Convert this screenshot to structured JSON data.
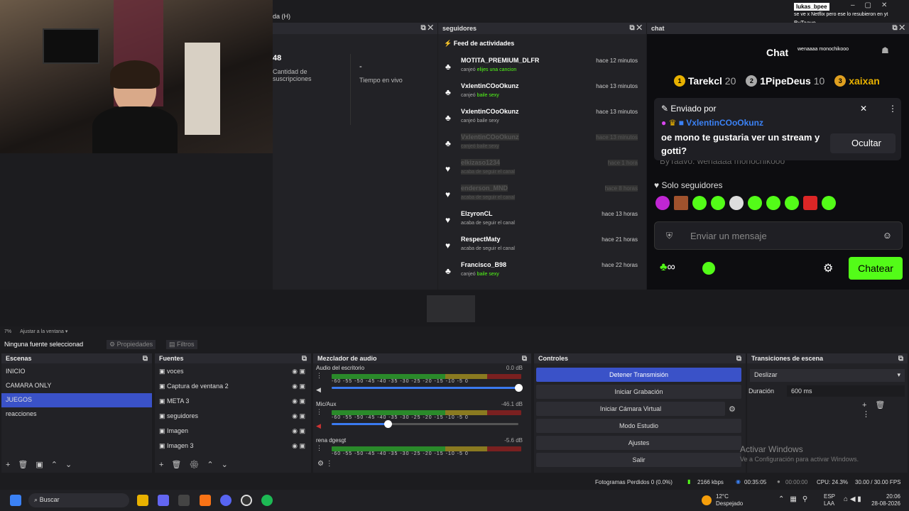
{
  "topbar": {
    "partial_title": "da (H)",
    "notif_user": "lukas_bpee",
    "notif_msg": "se ve x Netflix pero ese lo resubieron en yt",
    "notif_by": "ByTaavo",
    "notif_msg2": "wenaaaa monochikooo",
    "chat_heading": "Chat"
  },
  "stats_dock": {
    "count_partial": "48",
    "count_label": "Cantidad de suscripciones",
    "live_value": "-",
    "live_label": "Tiempo en vivo"
  },
  "followers_dock": {
    "title": "seguidores",
    "feed_title": "Feed de actividades",
    "rows": [
      {
        "icon": "♣",
        "name": "MOTITA_PREMIUM_DLFR",
        "act_prefix": "canjeó",
        "act_hl": "elijes una cancion",
        "time": "hace 12 minutos",
        "dim": false
      },
      {
        "icon": "♣",
        "name": "VxlentinCOoOkunz",
        "act_prefix": "canjeó",
        "act_hl": "baile sexy",
        "time": "hace 13 minutos",
        "dim": false
      },
      {
        "icon": "♣",
        "name": "VxlentinCOoOkunz",
        "act_prefix": "canjeó baile sexy",
        "act_hl": "",
        "time": "hace 13 minutos",
        "dim": false
      },
      {
        "icon": "♣",
        "name": "VxlentinCOoOkunz",
        "act_prefix": "canjeó baile sexy",
        "act_hl": "",
        "time": "hace 13 minutos",
        "dim": true
      },
      {
        "icon": "♥",
        "name": "elkizaso1234",
        "act_prefix": "acaba de seguir el canal",
        "act_hl": "",
        "time": "hace 1 hora",
        "dim": true
      },
      {
        "icon": "♥",
        "name": "enderson_MND",
        "act_prefix": "acaba de seguir el canal",
        "act_hl": "",
        "time": "hace 8 horas",
        "dim": true
      },
      {
        "icon": "♥",
        "name": "ElzyronCL",
        "act_prefix": "acaba de seguir el canal",
        "act_hl": "",
        "time": "hace 13 horas",
        "dim": false
      },
      {
        "icon": "♥",
        "name": "RespectMaty",
        "act_prefix": "acaba de seguir el canal",
        "act_hl": "",
        "time": "hace 21 horas",
        "dim": false
      },
      {
        "icon": "♣",
        "name": "Francisco_B98",
        "act_prefix": "canjeó",
        "act_hl": "baile sexy",
        "time": "hace 22 horas",
        "dim": false
      }
    ]
  },
  "chat_dock": {
    "title": "chat",
    "leaders": [
      {
        "rank": "1",
        "name": "Tarekcl",
        "score": "20",
        "color": "#e8b100"
      },
      {
        "rank": "2",
        "name": "1PipeDeus",
        "score": "10",
        "color": "#aaaaaa"
      },
      {
        "rank": "3",
        "name": "xaixan",
        "score": "",
        "color": "#e0a020"
      }
    ],
    "pinned_label": "Enviado por",
    "pinned_user": "VxlentinCOoOkunz",
    "pinned_msg": "oe mono te gustaria ver un stream y gotti?",
    "hide_label": "Ocultar",
    "bg_line": "ByTaavo: wenaaaa monochikooo",
    "followers_only": "Solo seguidores",
    "input_placeholder": "Enviar un mensaje",
    "chat_button": "Chatear"
  },
  "canvas_bar": {
    "zoom": "7%",
    "fit_label": "Ajustar a la ventana",
    "no_source": "Ninguna fuente seleccionad",
    "props_label": "Propiedades",
    "filters_label": "Filtros"
  },
  "scenes": {
    "title": "Escenas",
    "items": [
      "INICIO",
      "CAMARA ONLY",
      "JUEGOS",
      "reacciones"
    ],
    "selected": 2
  },
  "sources": {
    "title": "Fuentes",
    "items": [
      "voces",
      "Captura de ventana 2",
      "META 3",
      "seguidores",
      "Imagen",
      "Imagen 3"
    ]
  },
  "mixer": {
    "title": "Mezclador de audio",
    "ticks": "-60 -55 -50 -45 -40 -35 -30 -25 -20 -15 -10 -5 0",
    "channels": [
      {
        "name": "Audio del escritorio",
        "db": "0.0 dB",
        "volume": 1.0
      },
      {
        "name": "Mic/Aux",
        "db": "-46.1 dB",
        "volume": 0.3
      },
      {
        "name": "rena dgesgt",
        "db": "-5.6 dB",
        "volume": 0.0
      }
    ]
  },
  "controls": {
    "title": "Controles",
    "buttons": [
      "Detener Transmisión",
      "Iniciar Grabación",
      "Iniciar Cámara Virtual",
      "Modo Estudio",
      "Ajustes",
      "Salir"
    ]
  },
  "transitions": {
    "title": "Transiciones de escena",
    "selected": "Deslizar",
    "duration_label": "Duración",
    "duration_value": "600 ms",
    "watermark1": "Activar Windows",
    "watermark2": "Ve a Configuración para activar Windows."
  },
  "status": {
    "dropped": "Fotogramas Perdidos 0 (0.0%)",
    "bitrate": "2166 kbps",
    "stream_time": "00:35:05",
    "rec_time": "00:00:00",
    "cpu": "CPU: 24.3%",
    "fps": "30.00 / 30.00 FPS"
  },
  "taskbar": {
    "search": "Buscar",
    "weather_temp": "12°C",
    "weather_desc": "Despejado",
    "lang1": "ESP",
    "lang2": "LAA",
    "time": "20:06",
    "date": "28-08-2026"
  },
  "colors": {
    "kick_green": "#53fc18",
    "obs_blue": "#3a52c8"
  }
}
